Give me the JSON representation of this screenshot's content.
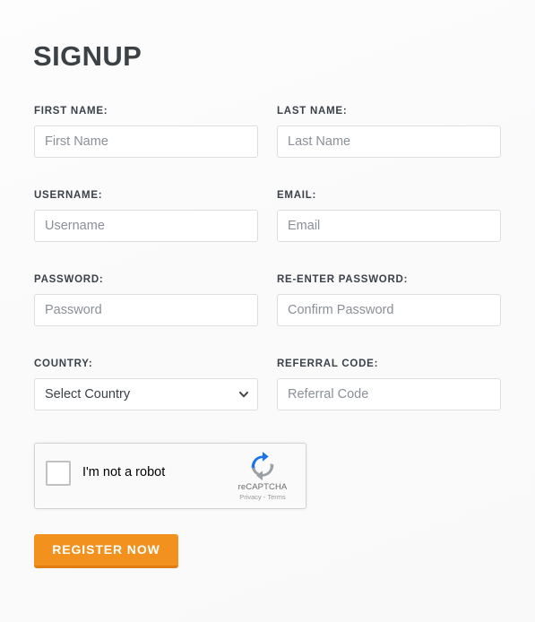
{
  "page": {
    "title": "SIGNUP",
    "background_color": "#fbfbfc"
  },
  "form": {
    "rows": [
      {
        "left": {
          "label": "FIRST NAME:",
          "placeholder": "First Name",
          "value": "",
          "type": "text"
        },
        "right": {
          "label": "LAST NAME:",
          "placeholder": "Last Name",
          "value": "",
          "type": "text"
        }
      },
      {
        "left": {
          "label": "USERNAME:",
          "placeholder": "Username",
          "value": "",
          "type": "text"
        },
        "right": {
          "label": "EMAIL:",
          "placeholder": "Email",
          "value": "",
          "type": "email"
        }
      },
      {
        "left": {
          "label": "PASSWORD:",
          "placeholder": "Password",
          "value": "",
          "type": "password"
        },
        "right": {
          "label": "RE-ENTER PASSWORD:",
          "placeholder": "Confirm Password",
          "value": "",
          "type": "password"
        }
      },
      {
        "left": {
          "label": "COUNTRY:",
          "placeholder": "Select Country",
          "value": "Select Country",
          "type": "select"
        },
        "right": {
          "label": "REFERRAL CODE:",
          "placeholder": "Referral Code",
          "value": "",
          "type": "text"
        }
      }
    ],
    "country_select": {
      "selected": "Select Country",
      "options": [
        "Select Country"
      ],
      "arrow_icon": "chevron-down-icon"
    }
  },
  "recaptcha": {
    "checkbox_checked": false,
    "label": "I'm not a robot",
    "brand_name": "reCAPTCHA",
    "links": "Privacy - Terms",
    "logo_icon": "recaptcha-logo-icon",
    "logo_blue": "#1c73e8",
    "logo_gray": "#9aa0a6"
  },
  "submit": {
    "label": "REGISTER NOW",
    "color": "#f2911d",
    "shadow_color": "#e07c13",
    "text_color": "#ffffff"
  }
}
